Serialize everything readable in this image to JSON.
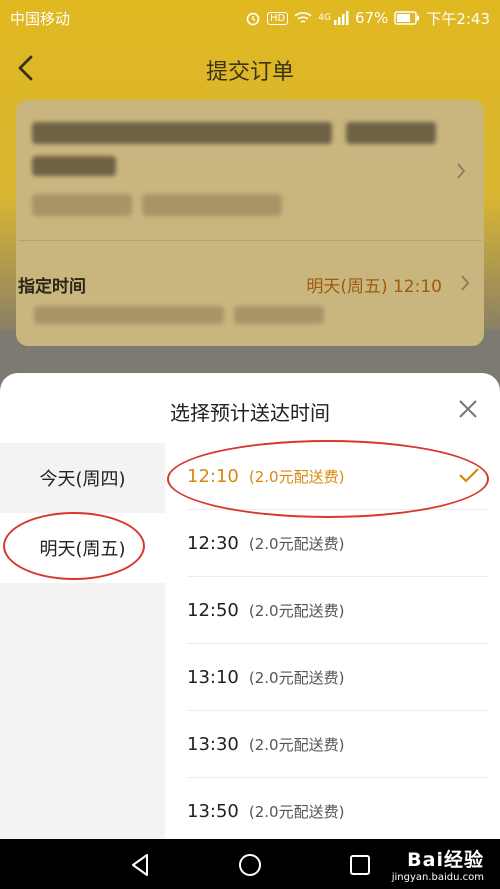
{
  "status": {
    "carrier": "中国移动",
    "battery": "67%",
    "time": "下午2:43",
    "hd_badge": "HD",
    "network": "4G"
  },
  "header": {
    "title": "提交订单"
  },
  "order_card": {
    "time_label": "指定时间",
    "time_value": "明天(周五) 12:10"
  },
  "sheet": {
    "title": "选择预计送达时间",
    "days": [
      {
        "label": "今天(周四)"
      },
      {
        "label": "明天(周五)"
      }
    ],
    "slots": [
      {
        "time": "12:10",
        "fee": "(2.0元配送费)"
      },
      {
        "time": "12:30",
        "fee": "(2.0元配送费)"
      },
      {
        "time": "12:50",
        "fee": "(2.0元配送费)"
      },
      {
        "time": "13:10",
        "fee": "(2.0元配送费)"
      },
      {
        "time": "13:30",
        "fee": "(2.0元配送费)"
      },
      {
        "time": "13:50",
        "fee": "(2.0元配送费)"
      }
    ]
  },
  "watermark": {
    "brand": "Bai经验",
    "url": "jingyan.baidu.com"
  },
  "colors": {
    "accent": "#d7890e",
    "annotation": "#d8372f",
    "brand_yellow": "#e0b820"
  }
}
